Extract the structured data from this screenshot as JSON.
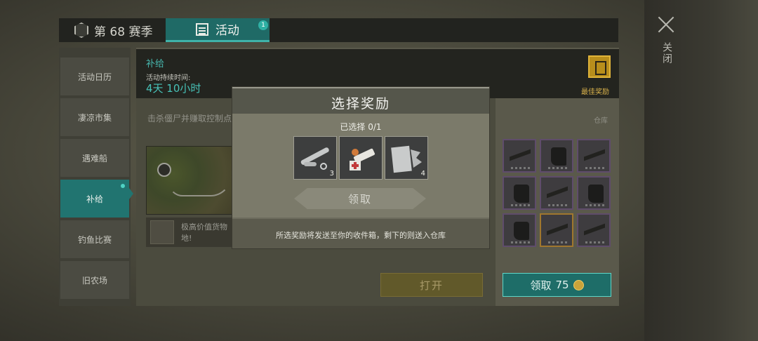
{
  "window": {
    "close_label": "关闭"
  },
  "tabs": {
    "season_label": "第 68 赛季",
    "activity_label": "活动",
    "activity_badge": "1"
  },
  "sidebar": {
    "items": [
      {
        "label": "活动日历"
      },
      {
        "label": "凄凉市集"
      },
      {
        "label": "遇难船"
      },
      {
        "label": "补给",
        "active": true
      },
      {
        "label": "钓鱼比赛"
      },
      {
        "label": "旧农场"
      }
    ]
  },
  "event": {
    "title": "补给",
    "duration_label": "活动持续时间:",
    "duration_value": "4天 10小时",
    "description": "击杀僵尸并赚取控制点",
    "item_description": "极高价值货物地!",
    "best_reward_label": "最佳奖励",
    "warehouse_label": "仓库",
    "open_button": "打开",
    "claim_button": "领取",
    "claim_cost": "75"
  },
  "modal": {
    "title": "选择奖励",
    "selected": "已选择 0/1",
    "rewards": [
      {
        "icon": "pipe-parts-icon",
        "qty": "3"
      },
      {
        "icon": "medical-syringe-icon",
        "qty": ""
      },
      {
        "icon": "metal-scrap-icon",
        "qty": "4"
      }
    ],
    "claim_button": "领取",
    "note": "所选奖励将发送至你的收件箱，剩下的则送入仓库"
  },
  "inventory": [
    {
      "icon": "rifle-icon"
    },
    {
      "icon": "boots-icon"
    },
    {
      "icon": "shotgun-icon"
    },
    {
      "icon": "boots-icon"
    },
    {
      "icon": "rifle-icon"
    },
    {
      "icon": "boots-icon"
    },
    {
      "icon": "boots-icon"
    },
    {
      "icon": "shotgun-icon"
    },
    {
      "icon": "rifle-icon"
    }
  ],
  "colors": {
    "accent": "#217470",
    "gold": "#b88e1c",
    "rare_border": "#5f4c6b"
  }
}
